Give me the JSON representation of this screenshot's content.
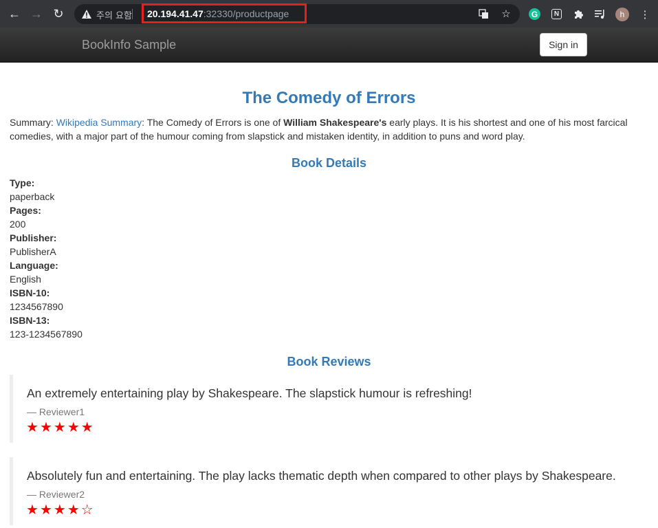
{
  "browser": {
    "warning_text": "주의 요함",
    "url_host": "20.194.41.47",
    "url_path": ":32330/productpage",
    "avatar_letter": "h",
    "grammarly_letter": "G",
    "notion_letter": "N"
  },
  "navbar": {
    "brand": "BookInfo Sample",
    "signin_label": "Sign in"
  },
  "book": {
    "title": "The Comedy of Errors",
    "summary_prefix": "Summary: ",
    "summary_link": "Wikipedia Summary",
    "summary_mid": ": The Comedy of Errors is one of ",
    "summary_bold": "William Shakespeare's",
    "summary_rest": " early plays. It is his shortest and one of his most farcical comedies, with a major part of the humour coming from slapstick and mistaken identity, in addition to puns and word play."
  },
  "details": {
    "heading": "Book Details",
    "items": [
      {
        "label": "Type:",
        "value": "paperback"
      },
      {
        "label": "Pages:",
        "value": "200"
      },
      {
        "label": "Publisher:",
        "value": "PublisherA"
      },
      {
        "label": "Language:",
        "value": "English"
      },
      {
        "label": "ISBN-10:",
        "value": "1234567890"
      },
      {
        "label": "ISBN-13:",
        "value": "123-1234567890"
      }
    ]
  },
  "reviews": {
    "heading": "Book Reviews",
    "items": [
      {
        "text": "An extremely entertaining play by Shakespeare. The slapstick humour is refreshing!",
        "reviewer": "— Reviewer1",
        "rating": 5,
        "max": 5
      },
      {
        "text": "Absolutely fun and entertaining. The play lacks thematic depth when compared to other plays by Shakespeare.",
        "reviewer": "— Reviewer2",
        "rating": 4,
        "max": 5
      }
    ]
  },
  "colors": {
    "link": "#337ab7",
    "star": "#ff0000",
    "url_highlight": "#e5201f"
  }
}
